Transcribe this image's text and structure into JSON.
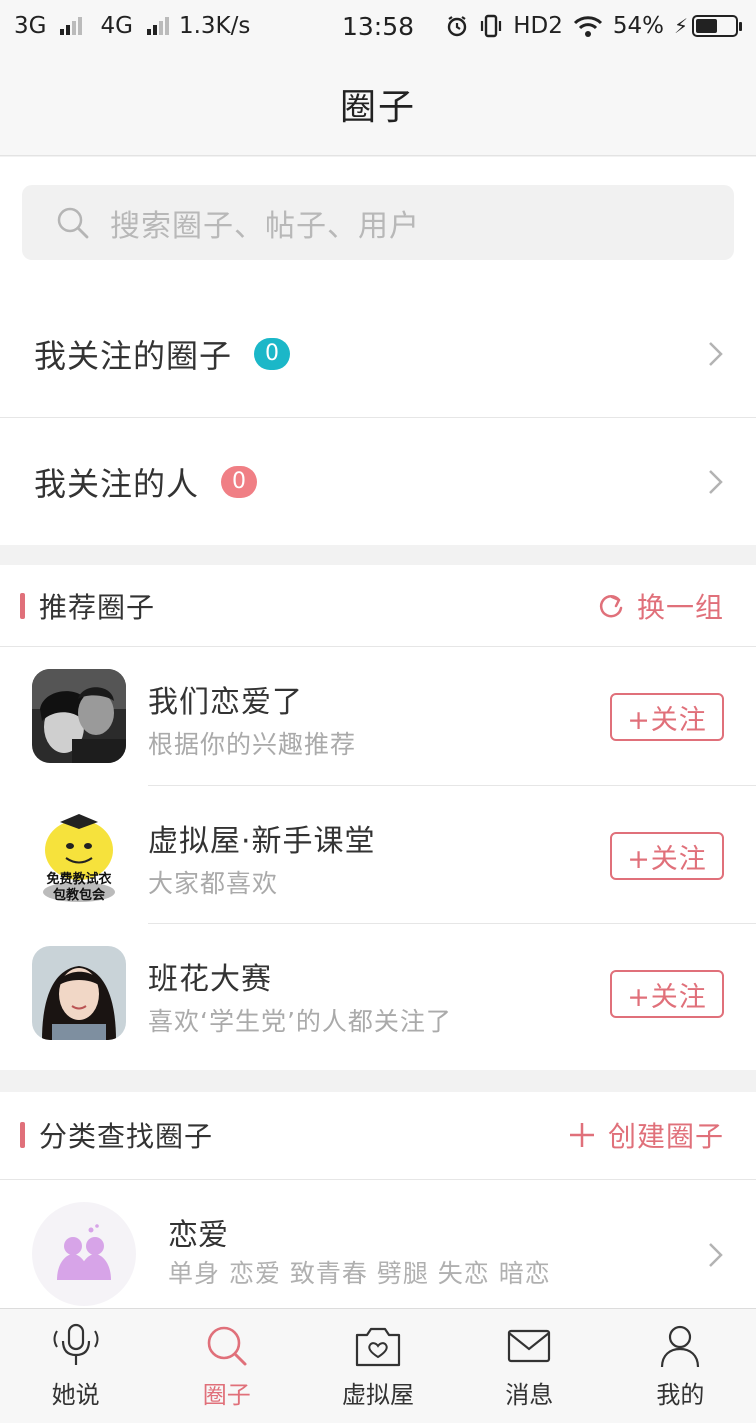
{
  "status_bar": {
    "network1": "3G",
    "network2": "4G",
    "speed": "1.3K/s",
    "time": "13:58",
    "hd": "HD2",
    "battery": "54%",
    "battery_level": 0.54
  },
  "header": {
    "title": "圈子"
  },
  "search": {
    "placeholder": "搜索圈子、帖子、用户"
  },
  "follow": {
    "circles": {
      "label": "我关注的圈子",
      "count": "0",
      "badge_color": "#1bb7c8"
    },
    "people": {
      "label": "我关注的人",
      "count": "0",
      "badge_color": "#f07f85"
    }
  },
  "recommend": {
    "title": "推荐圈子",
    "refresh_label": "换一组",
    "follow_label": "+关注",
    "items": [
      {
        "name": "我们恋爱了",
        "desc": "根据你的兴趣推荐"
      },
      {
        "name": "虚拟屋·新手课堂",
        "desc": "大家都喜欢",
        "avatar_text_1": "免费教试衣",
        "avatar_text_2": "包教包会"
      },
      {
        "name": "班花大赛",
        "desc": "喜欢‘学生党’的人都关注了"
      }
    ]
  },
  "categories": {
    "title": "分类查找圈子",
    "create_label": "创建圈子",
    "items": [
      {
        "name": "恋爱",
        "tags": "单身 恋爱 致青春 劈腿 失恋 暗恋"
      }
    ]
  },
  "tabs": [
    {
      "label": "她说",
      "icon": "microphone-icon",
      "active": false
    },
    {
      "label": "圈子",
      "icon": "search-icon",
      "active": true
    },
    {
      "label": "虚拟屋",
      "icon": "camera-heart-icon",
      "active": false
    },
    {
      "label": "消息",
      "icon": "mail-icon",
      "active": false
    },
    {
      "label": "我的",
      "icon": "person-icon",
      "active": false
    }
  ],
  "colors": {
    "accent": "#e0707a",
    "teal": "#1bb7c8"
  }
}
